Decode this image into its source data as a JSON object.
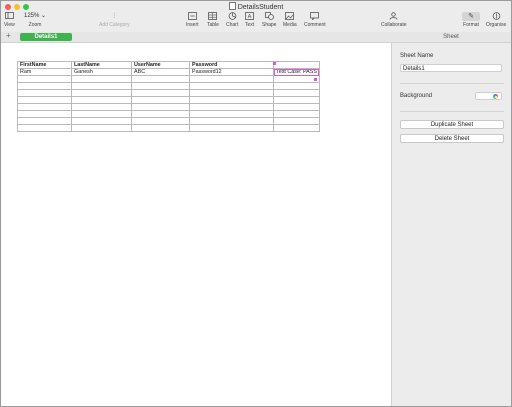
{
  "window": {
    "title": "DetailsStudent"
  },
  "toolbar": {
    "view_label": "View",
    "zoom_value": "125%",
    "zoom_label": "Zoom",
    "add_category_label": "Add Category",
    "insert_label": "Insert",
    "table_label": "Table",
    "chart_label": "Chart",
    "text_label": "Text",
    "shape_label": "Shape",
    "media_label": "Media",
    "comment_label": "Comment",
    "collaborate_label": "Collaborate",
    "format_label": "Format",
    "organise_label": "Organise"
  },
  "tabs": {
    "add_symbol": "+",
    "sheets": [
      {
        "label": "Details1",
        "active": true
      }
    ],
    "inspector_tab": "Sheet"
  },
  "table": {
    "headers": [
      "FirstName",
      "LastName",
      "UserName",
      "Password",
      ""
    ],
    "rows": [
      [
        "Ram",
        "Ganesh",
        "ABC",
        "Password12",
        "Test Case: PASS"
      ],
      [
        "",
        "",
        "",
        "",
        ""
      ],
      [
        "",
        "",
        "",
        "",
        ""
      ],
      [
        "",
        "",
        "",
        "",
        ""
      ],
      [
        "",
        "",
        "",
        "",
        ""
      ],
      [
        "",
        "",
        "",
        "",
        ""
      ],
      [
        "",
        "",
        "",
        "",
        ""
      ],
      [
        "",
        "",
        "",
        "",
        ""
      ],
      [
        "",
        "",
        "",
        "",
        ""
      ]
    ]
  },
  "inspector": {
    "sheet_name_label": "Sheet Name",
    "sheet_name_value": "Details1",
    "background_label": "Background",
    "duplicate_label": "Duplicate Sheet",
    "delete_label": "Delete Sheet"
  },
  "colors": {
    "accent_green": "#3fb34f",
    "selection_magenta": "#d65ad6",
    "toolbar_bg": "#ececec"
  },
  "icons": {
    "view": "sidebar-icon",
    "zoom": "chevron-down-icon",
    "add_category": "add-category-icon",
    "insert": "insert-icon",
    "table": "table-icon",
    "chart": "chart-icon",
    "text": "text-icon",
    "shape": "shape-icon",
    "media": "media-icon",
    "comment": "comment-icon",
    "collaborate": "collaborate-icon",
    "format": "paintbrush-icon",
    "organise": "organise-icon"
  }
}
